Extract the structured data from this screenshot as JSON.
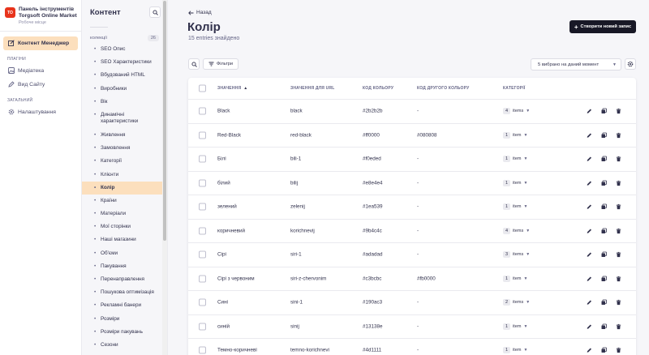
{
  "brand": {
    "logo_text": "TO",
    "title_line1": "Панель інструментів",
    "title_line2": "Torgsoft Online Market",
    "subtitle": "Робоче місце"
  },
  "mainnav": {
    "content_manager": "Контент Менеджер",
    "plugins_section": "ПЛАГІНИ",
    "media": "Медіатека",
    "view_site": "Вид Сайту",
    "general_section": "ЗАГАЛЬНИЙ",
    "settings": "Налаштування"
  },
  "subnav": {
    "title": "Контент",
    "group_label": "колекції",
    "group_count": "26",
    "items": [
      "SEO Опис",
      "SEO Характеристики",
      "Вбудований HTML",
      "Виробники",
      "Вік",
      "Динамічні характеристики",
      "Живлення",
      "Замовлення",
      "Категорії",
      "Клієнти",
      "Колір",
      "Країни",
      "Матеріали",
      "Мої сторінки",
      "Наші магазини",
      "Об'єми",
      "Пакування",
      "Перенаправлення",
      "Пошукова оптимізація",
      "Рекламні банери",
      "Розміри",
      "Розміри пакувань",
      "Сезони"
    ]
  },
  "page": {
    "back": "Назад",
    "title": "Колір",
    "subtitle": "15 entries знайдено",
    "create_button": "Створити новий запис",
    "filters_button": "Фільтри",
    "view_select": "5 вибрано на даний момент"
  },
  "table": {
    "headers": {
      "value": "ЗНАЧЕННЯ",
      "url": "ЗНАЧЕННЯ ДЛЯ URL",
      "code": "КОД КОЛЬОРУ",
      "other_code": "КОД ДРУГОГО КОЛЬОРУ",
      "categories": "КАТЕГОРІЇ"
    },
    "rows": [
      {
        "value": "Black",
        "url": "black",
        "code": "#2b2b2b",
        "other": "-",
        "count": "4",
        "unit": "items"
      },
      {
        "value": "Red-Black",
        "url": "red-black",
        "code": "#ff0000",
        "other": "#080808",
        "count": "1",
        "unit": "item"
      },
      {
        "value": "Білі",
        "url": "bili-1",
        "code": "#f0eded",
        "other": "-",
        "count": "1",
        "unit": "item"
      },
      {
        "value": "білий",
        "url": "bilij",
        "code": "#e8e4e4",
        "other": "-",
        "count": "1",
        "unit": "item"
      },
      {
        "value": "зелений",
        "url": "zelenij",
        "code": "#1ea539",
        "other": "-",
        "count": "1",
        "unit": "item"
      },
      {
        "value": "коричневий",
        "url": "korichnevij",
        "code": "#9b4c4c",
        "other": "-",
        "count": "4",
        "unit": "items"
      },
      {
        "value": "Сірі",
        "url": "siri-1",
        "code": "#adadad",
        "other": "-",
        "count": "3",
        "unit": "items"
      },
      {
        "value": "Сірі з червоним",
        "url": "siri-z-chervonim",
        "code": "#c3bcbc",
        "other": "#fb0000",
        "count": "1",
        "unit": "item"
      },
      {
        "value": "Сині",
        "url": "sini-1",
        "code": "#190ac3",
        "other": "-",
        "count": "2",
        "unit": "items"
      },
      {
        "value": "синій",
        "url": "sinij",
        "code": "#13138e",
        "other": "-",
        "count": "1",
        "unit": "item"
      },
      {
        "value": "Темно-коричневі",
        "url": "temno-korichnevi",
        "code": "#4d1111",
        "other": "-",
        "count": "1",
        "unit": "item"
      }
    ]
  }
}
